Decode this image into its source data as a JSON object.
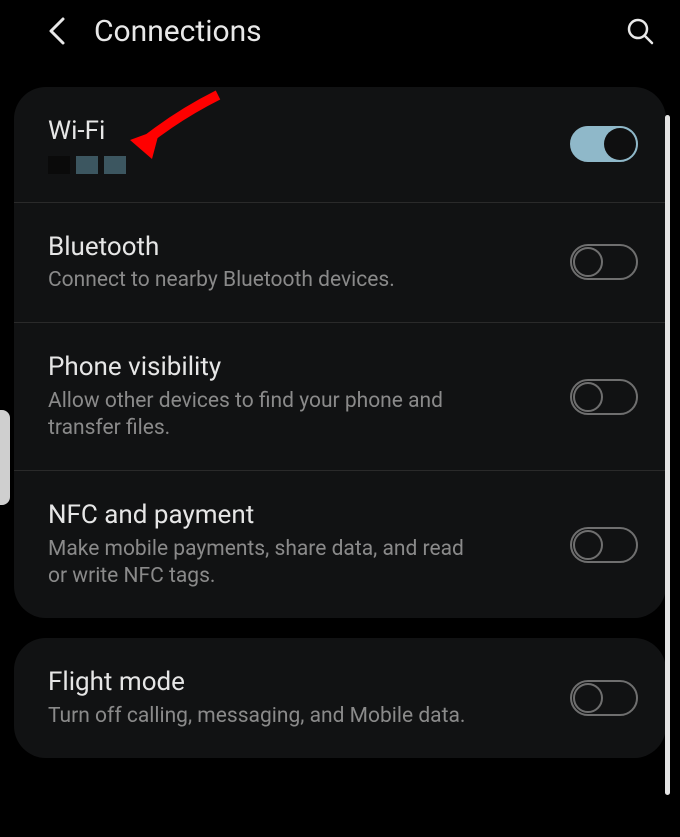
{
  "header": {
    "title": "Connections"
  },
  "settings": [
    {
      "key": "wifi",
      "title": "Wi-Fi",
      "subtitle": "",
      "enabled": true,
      "redacted": true
    },
    {
      "key": "bluetooth",
      "title": "Bluetooth",
      "subtitle": "Connect to nearby Bluetooth devices.",
      "enabled": false
    },
    {
      "key": "phone-visibility",
      "title": "Phone visibility",
      "subtitle": "Allow other devices to find your phone and transfer files.",
      "enabled": false
    },
    {
      "key": "nfc",
      "title": "NFC and payment",
      "subtitle": "Make mobile payments, share data, and read or write NFC tags.",
      "enabled": false
    }
  ],
  "settings2": [
    {
      "key": "flight-mode",
      "title": "Flight mode",
      "subtitle": "Turn off calling, messaging, and Mobile data.",
      "enabled": false
    }
  ]
}
